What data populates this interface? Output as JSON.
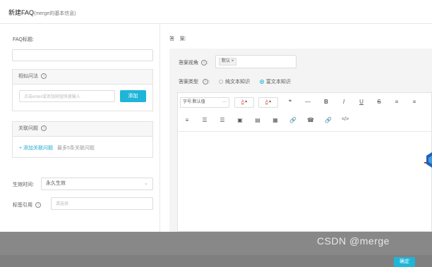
{
  "header": {
    "title": "新建FAQ",
    "subtitle": "(merge的基本信息)"
  },
  "left": {
    "faq_title_label": "FAQ标题:",
    "similar_label": "相似问法",
    "similar_placeholder": "点击enter或添加按钮快速输入",
    "add_label": "添加",
    "related_label": "关联问题",
    "add_related_label": "+ 添加关联问题",
    "related_limit": "最多5条关联问题",
    "effective_label": "生效时间:",
    "effective_value": "永久生效",
    "tag_label": "标签引用",
    "tag_placeholder": "请选择"
  },
  "right": {
    "answer_label": "答    案:",
    "view_label": "答案视角",
    "view_tag": "默认",
    "type_label": "答案类型",
    "type_option1": "纯文本知识",
    "type_option2": "富文本知识",
    "font_size_label": "字号:默认值",
    "toolbar_row1": [
      "❝",
      "—",
      "B",
      "I",
      "U",
      "S",
      "≡",
      "≡"
    ],
    "toolbar_row2": [
      "≡",
      "☰",
      "☰",
      "▣",
      "▤",
      "▦",
      "🔗",
      "☎",
      "🔗",
      "</>"
    ]
  },
  "footer": {
    "watermark": "CSDN @merge",
    "confirm_label": "确定"
  },
  "colors": {
    "accent": "#1fb5d9",
    "font_color": "#e53935"
  }
}
